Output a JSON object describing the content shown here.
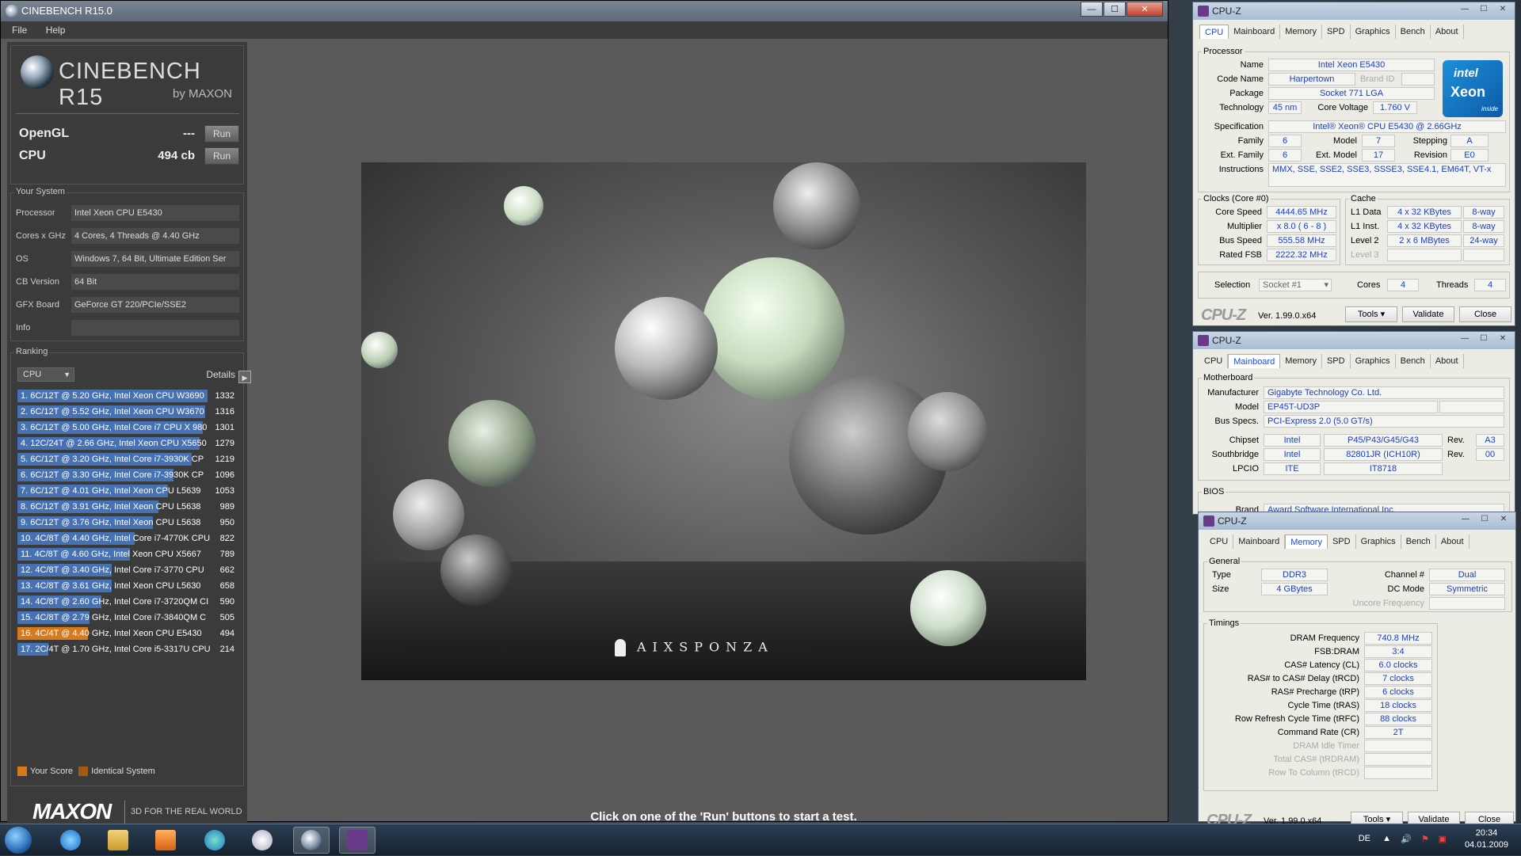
{
  "cinebench": {
    "title": "CINEBENCH R15.0",
    "menu": [
      "File",
      "Help"
    ],
    "logo": "CINEBENCH R15",
    "logo_sub": "by MAXON",
    "opengl_label": "OpenGL",
    "opengl_value": "---",
    "cpu_label": "CPU",
    "cpu_value": "494 cb",
    "run_label": "Run",
    "your_system_title": "Your System",
    "system": [
      {
        "label": "Processor",
        "value": "Intel Xeon CPU E5430"
      },
      {
        "label": "Cores x GHz",
        "value": "4 Cores, 4 Threads @ 4.40 GHz"
      },
      {
        "label": "OS",
        "value": "Windows 7, 64 Bit, Ultimate Edition Ser"
      },
      {
        "label": "CB Version",
        "value": "64 Bit"
      },
      {
        "label": "GFX Board",
        "value": "GeForce GT 220/PCIe/SSE2"
      },
      {
        "label": "Info",
        "value": ""
      }
    ],
    "ranking_title": "Ranking",
    "ranking_select": "CPU",
    "details_label": "Details",
    "ranking_max": 1332,
    "ranking": [
      {
        "text": "1. 6C/12T @ 5.20 GHz, Intel Xeon CPU W3690",
        "score": 1332,
        "mine": false
      },
      {
        "text": "2. 6C/12T @ 5.52 GHz, Intel Xeon CPU W3670",
        "score": 1316,
        "mine": false
      },
      {
        "text": "3. 6C/12T @ 5.00 GHz, Intel Core i7 CPU X 980",
        "score": 1301,
        "mine": false
      },
      {
        "text": "4. 12C/24T @ 2.66 GHz, Intel Xeon CPU X5650",
        "score": 1279,
        "mine": false
      },
      {
        "text": "5. 6C/12T @ 3.20 GHz,  Intel Core i7-3930K CP",
        "score": 1219,
        "mine": false
      },
      {
        "text": "6. 6C/12T @ 3.30 GHz,  Intel Core i7-3930K CP",
        "score": 1096,
        "mine": false
      },
      {
        "text": "7. 6C/12T @ 4.01 GHz, Intel Xeon CPU L5639",
        "score": 1053,
        "mine": false
      },
      {
        "text": "8. 6C/12T @ 3.91 GHz, Intel Xeon CPU L5638",
        "score": 989,
        "mine": false
      },
      {
        "text": "9. 6C/12T @ 3.76 GHz, Intel Xeon CPU L5638",
        "score": 950,
        "mine": false
      },
      {
        "text": "10. 4C/8T @ 4.40 GHz, Intel Core i7-4770K CPU",
        "score": 822,
        "mine": false
      },
      {
        "text": "11. 4C/8T @ 4.60 GHz, Intel Xeon CPU X5667",
        "score": 789,
        "mine": false
      },
      {
        "text": "12. 4C/8T @ 3.40 GHz,  Intel Core i7-3770 CPU",
        "score": 662,
        "mine": false
      },
      {
        "text": "13. 4C/8T @ 3.61 GHz, Intel Xeon CPU L5630",
        "score": 658,
        "mine": false
      },
      {
        "text": "14. 4C/8T @ 2.60 GHz, Intel Core i7-3720QM CI",
        "score": 590,
        "mine": false
      },
      {
        "text": "15. 4C/8T @ 2.79 GHz,  Intel Core i7-3840QM C",
        "score": 505,
        "mine": false
      },
      {
        "text": "16. 4C/4T @ 4.40 GHz, Intel Xeon CPU E5430",
        "score": 494,
        "mine": true
      },
      {
        "text": "17. 2C/4T @ 1.70 GHz,  Intel Core i5-3317U CPU",
        "score": 214,
        "mine": false
      }
    ],
    "legend_your": "Your Score",
    "legend_identical": "Identical System",
    "maxon": "MAXON",
    "maxon_tag": "3D FOR THE REAL WORLD",
    "render_credit": "AIXSPONZA",
    "status": "Click on one of the 'Run' buttons to start a test.",
    "colors": {
      "bar": "#4672b4",
      "mine": "#d77a1c"
    }
  },
  "cpuz1": {
    "title": "CPU-Z",
    "tabs": [
      "CPU",
      "Mainboard",
      "Memory",
      "SPD",
      "Graphics",
      "Bench",
      "About"
    ],
    "processor_group": "Processor",
    "name_label": "Name",
    "name": "Intel Xeon E5430",
    "codename_label": "Code Name",
    "codename": "Harpertown",
    "brandid_label": "Brand ID",
    "package_label": "Package",
    "package": "Socket 771 LGA",
    "technology_label": "Technology",
    "technology": "45 nm",
    "voltage_label": "Core Voltage",
    "voltage": "1.760 V",
    "spec_label": "Specification",
    "spec": "Intel® Xeon® CPU         E5430  @ 2.66GHz",
    "family_label": "Family",
    "family": "6",
    "model_label": "Model",
    "model": "7",
    "stepping_label": "Stepping",
    "stepping": "A",
    "extfamily_label": "Ext. Family",
    "extfamily": "6",
    "extmodel_label": "Ext. Model",
    "extmodel": "17",
    "revision_label": "Revision",
    "revision": "E0",
    "instructions_label": "Instructions",
    "instructions": "MMX, SSE, SSE2, SSE3, SSSE3, SSE4.1, EM64T, VT-x",
    "clocks_group": "Clocks (Core #0)",
    "corespeed_label": "Core Speed",
    "corespeed": "4444.65 MHz",
    "multiplier_label": "Multiplier",
    "multiplier": "x 8.0 ( 6 - 8 )",
    "busspeed_label": "Bus Speed",
    "busspeed": "555.58 MHz",
    "ratedfsb_label": "Rated FSB",
    "ratedfsb": "2222.32 MHz",
    "cache_group": "Cache",
    "l1d_label": "L1 Data",
    "l1d": "4 x 32 KBytes",
    "l1d_way": "8-way",
    "l1i_label": "L1 Inst.",
    "l1i": "4 x 32 KBytes",
    "l1i_way": "8-way",
    "l2_label": "Level 2",
    "l2": "2 x 6 MBytes",
    "l2_way": "24-way",
    "l3_label": "Level 3",
    "selection_label": "Selection",
    "selection": "Socket #1",
    "cores_label": "Cores",
    "cores": "4",
    "threads_label": "Threads",
    "threads": "4",
    "brand": "CPU-Z",
    "version": "Ver. 1.99.0.x64",
    "tools": "Tools",
    "validate": "Validate",
    "close": "Close",
    "intel_a": "intel",
    "intel_b": "Xeon",
    "intel_c": "inside"
  },
  "cpuz2": {
    "title": "CPU-Z",
    "tabs": [
      "CPU",
      "Mainboard",
      "Memory",
      "SPD",
      "Graphics",
      "Bench",
      "About"
    ],
    "motherboard_group": "Motherboard",
    "manufacturer_label": "Manufacturer",
    "manufacturer": "Gigabyte Technology Co. Ltd.",
    "model_label": "Model",
    "model": "EP45T-UD3P",
    "busspecs_label": "Bus Specs.",
    "busspecs": "PCI-Express 2.0 (5.0 GT/s)",
    "chipset_label": "Chipset",
    "chipset_v": "Intel",
    "chipset_m": "P45/P43/G45/G43",
    "rev_label": "Rev.",
    "chipset_rev": "A3",
    "south_label": "Southbridge",
    "south_v": "Intel",
    "south_m": "82801JR (ICH10R)",
    "south_rev": "00",
    "lpcio_label": "LPCIO",
    "lpcio_v": "ITE",
    "lpcio_m": "IT8718",
    "bios_group": "BIOS",
    "brand_label": "Brand",
    "bios_brand": "Award Software International Inc."
  },
  "cpuz3": {
    "title": "CPU-Z",
    "tabs": [
      "CPU",
      "Mainboard",
      "Memory",
      "SPD",
      "Graphics",
      "Bench",
      "About"
    ],
    "general_group": "General",
    "type_label": "Type",
    "type": "DDR3",
    "channel_label": "Channel #",
    "channel": "Dual",
    "size_label": "Size",
    "size": "4 GBytes",
    "dcmode_label": "DC Mode",
    "dcmode": "Symmetric",
    "uncore_label": "Uncore Frequency",
    "timings_group": "Timings",
    "timings": [
      {
        "label": "DRAM Frequency",
        "value": "740.8 MHz",
        "gray": false
      },
      {
        "label": "FSB:DRAM",
        "value": "3:4",
        "gray": false
      },
      {
        "label": "CAS# Latency (CL)",
        "value": "6.0 clocks",
        "gray": false
      },
      {
        "label": "RAS# to CAS# Delay (tRCD)",
        "value": "7 clocks",
        "gray": false
      },
      {
        "label": "RAS# Precharge (tRP)",
        "value": "6 clocks",
        "gray": false
      },
      {
        "label": "Cycle Time (tRAS)",
        "value": "18 clocks",
        "gray": false
      },
      {
        "label": "Row Refresh Cycle Time (tRFC)",
        "value": "88 clocks",
        "gray": false
      },
      {
        "label": "Command Rate (CR)",
        "value": "2T",
        "gray": false
      },
      {
        "label": "DRAM Idle Timer",
        "value": "",
        "gray": true
      },
      {
        "label": "Total CAS# (tRDRAM)",
        "value": "",
        "gray": true
      },
      {
        "label": "Row To Column (tRCD)",
        "value": "",
        "gray": true
      }
    ],
    "brand": "CPU-Z",
    "version": "Ver. 1.99.0.x64",
    "tools": "Tools",
    "validate": "Validate",
    "close": "Close"
  },
  "taskbar": {
    "lang": "DE",
    "time": "20:34",
    "date": "04.01.2009"
  }
}
